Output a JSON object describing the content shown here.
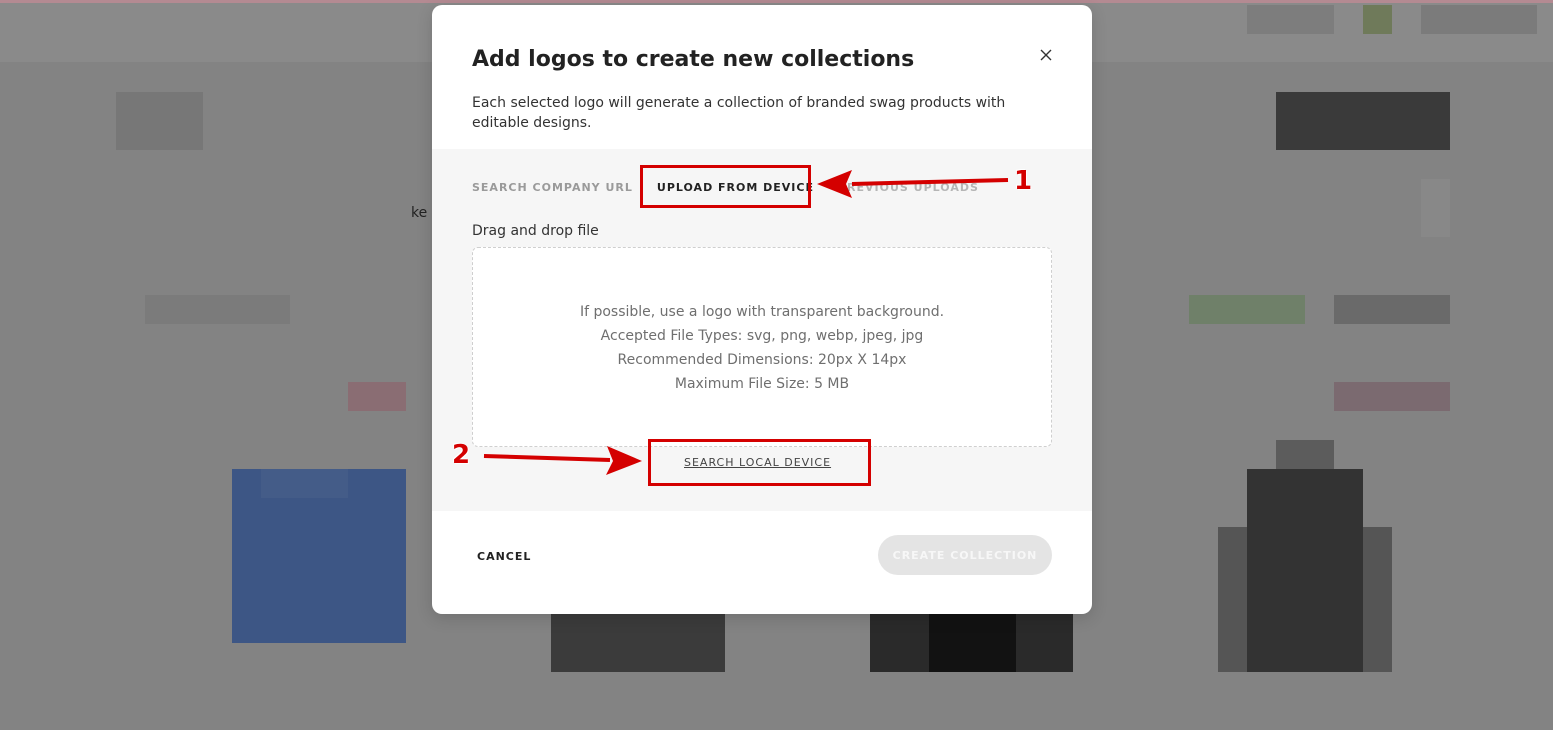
{
  "modal": {
    "title": "Add logos to create new collections",
    "description": "Each selected logo will generate a collection of branded swag products with editable designs.",
    "tabs": [
      {
        "label": "SEARCH COMPANY URL",
        "active": false
      },
      {
        "label": "UPLOAD FROM DEVICE",
        "active": true
      },
      {
        "label": "PREVIOUS UPLOADS",
        "active": false
      }
    ],
    "drag_label": "Drag and drop file",
    "dropzone_lines": [
      "If possible, use a logo with transparent background.",
      "Accepted File Types: svg, png, webp, jpeg, jpg",
      "Recommended Dimensions: 20px X 14px",
      "Maximum File Size: 5 MB"
    ],
    "search_local_label": "SEARCH LOCAL DEVICE",
    "cancel_label": "CANCEL",
    "create_label": "CREATE COLLECTION"
  },
  "background": {
    "partial_text": "ke"
  },
  "annotations": [
    {
      "number": "1"
    },
    {
      "number": "2"
    }
  ],
  "colors": {
    "annotation_red": "#d40000",
    "overlay_gray": "#838383",
    "disabled_button": "#e4e4e4"
  }
}
